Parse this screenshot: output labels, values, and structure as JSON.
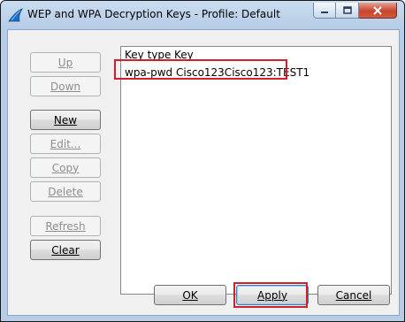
{
  "window": {
    "title": "WEP and WPA Decryption Keys - Profile: Default"
  },
  "side_buttons": {
    "up": "Up",
    "down": "Down",
    "new": "New",
    "edit": "Edit...",
    "copy": "Copy",
    "delete": "Delete",
    "refresh": "Refresh",
    "clear": "Clear"
  },
  "list": {
    "columns": [
      "Key type",
      "Key"
    ],
    "rows": [
      {
        "key_type": "wpa-pwd",
        "key": "Cisco123Cisco123:TEST1"
      }
    ]
  },
  "footer": {
    "ok": "OK",
    "apply": "Apply",
    "cancel": "Cancel"
  },
  "colors": {
    "highlight": "#d21f2b",
    "accent": "#3c7fb1"
  }
}
